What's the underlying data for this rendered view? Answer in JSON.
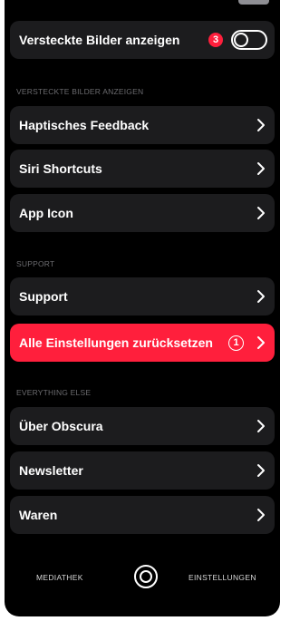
{
  "rows": {
    "hidden_images": {
      "label": "Versteckte Bilder anzeigen",
      "badge": "3"
    },
    "haptic": {
      "label": "Haptisches Feedback"
    },
    "siri": {
      "label": "Siri Shortcuts"
    },
    "app_icon": {
      "label": "App Icon"
    },
    "support": {
      "label": "Support"
    },
    "reset": {
      "label": "Alle Einstellungen zurücksetzen",
      "badge": "1"
    },
    "about": {
      "label": "Über Obscura"
    },
    "newsletter": {
      "label": "Newsletter"
    },
    "merch": {
      "label": "Waren"
    }
  },
  "sections": {
    "hidden_images": "VERSTECKTE BILDER ANZEIGEN",
    "support": "SUPPORT",
    "everything_else": "EVERYTHING ELSE"
  },
  "tabbar": {
    "left": "MEDIATHEK",
    "right": "EINSTELLUNGEN"
  },
  "toggle": {
    "on": false
  },
  "colors": {
    "background": "#000000",
    "row": "#1c1c1e",
    "accent_red": "#ff1f3c",
    "section_text": "#6b6b6f"
  },
  "icons": {
    "chevron": "chevron-right-icon",
    "shutter": "shutter-icon"
  }
}
